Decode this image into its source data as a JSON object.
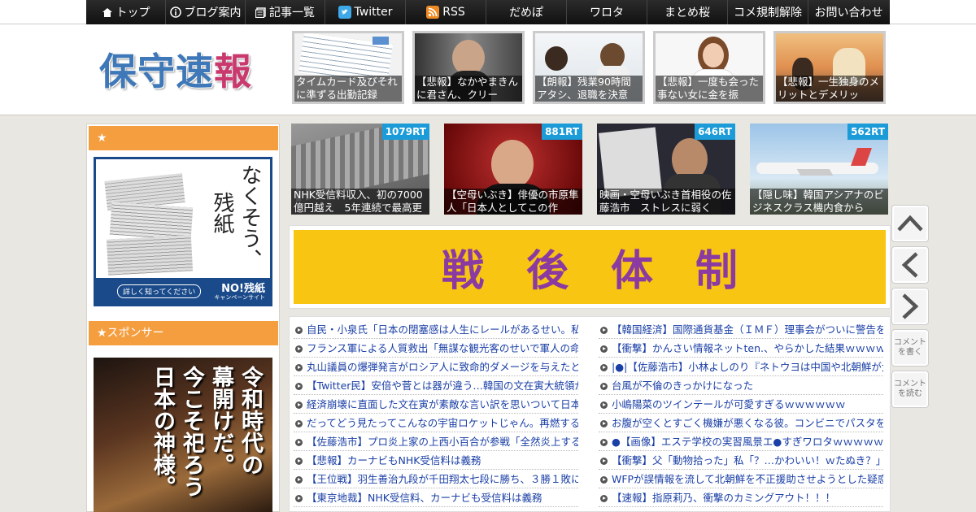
{
  "nav": [
    {
      "label": "トップ",
      "icon": "home-icon"
    },
    {
      "label": "ブログ案内",
      "icon": "info-icon"
    },
    {
      "label": "記事一覧",
      "icon": "list-icon"
    },
    {
      "label": "Twitter",
      "icon": "twitter-icon"
    },
    {
      "label": "RSS",
      "icon": "rss-icon"
    },
    {
      "label": "だめぽ",
      "icon": ""
    },
    {
      "label": "ワロタ",
      "icon": ""
    },
    {
      "label": "まとめ桜",
      "icon": ""
    },
    {
      "label": "コメ規制解除",
      "icon": ""
    },
    {
      "label": "お問い合わせ",
      "icon": ""
    }
  ],
  "logo": {
    "c1": "保",
    "c2": "守",
    "c3": "速",
    "c4": "報"
  },
  "header_thumbs": [
    {
      "caption": "タイムカード及びそれに準ずる出勤記録"
    },
    {
      "caption": "【悲報】なかやまきんに君さん、クリー"
    },
    {
      "caption": "【朗報】残業90時間アタシ、退職を決意"
    },
    {
      "caption": "【悲報】一度も会った事ない女に金を振"
    },
    {
      "caption": "【悲報】一生独身のメリットとデメリッ"
    }
  ],
  "sidebar": {
    "head1": "★",
    "head2": "★スポンサー",
    "banner1": {
      "vtext1": "なくそう、",
      "vtext2": "残紙",
      "button": "詳しく知ってください",
      "brand": "NO!残紙",
      "brand_sub": "キャンペーンサイト"
    },
    "banner2": {
      "col1": "令和時代の",
      "col2": "幕開けだ。",
      "col3": "今こそ祀ろう",
      "col4": "日本の神様。"
    }
  },
  "ranking": [
    {
      "rt": "1079RT",
      "caption": "NHK受信料収入、初の7000億円越え　5年連続で最高更"
    },
    {
      "rt": "881RT",
      "caption": "【空母いぶき】俳優の市原隼人「日本人としてこの作"
    },
    {
      "rt": "646RT",
      "caption": "映画・空母いぶき首相役の佐藤浩市　ストレスに弱く"
    },
    {
      "rt": "562RT",
      "caption": "【隠し味】韓国アシアナのビジネスクラス機内食から"
    }
  ],
  "kanban": [
    "戦",
    "後",
    "体",
    "制"
  ],
  "news_left": [
    "自民・小泉氏「日本の閉塞感は人生にレールがあるせい。私が",
    "フランス軍による人質救出「無謀な観光客のせいで軍人の命が",
    "丸山議員の爆弾発言がロシア人に致命的ダメージを与えたと発",
    "【Twitter民】安倍や菅とは器が違う…韓国の文在寅大統領が羨",
    "経済崩壊に直面した文在寅が素敵な言い訳を思いついて日本側",
    "だってどう見たってこんなの宇宙ロケットじゃん。再燃するマ",
    "【佐藤浩市】プロ炎上家の上西小百合が参戦「全然炎上するよ",
    "【悲報】カーナビもNHK受信料は義務",
    "【王位戦】羽生善治九段が千田翔太七段に勝ち、３勝１敗に",
    "【東京地裁】NHK受信料、カーナビも受信料は義務"
  ],
  "news_right": [
    "【韓国経済】国際通貨基金（ＩＭＦ）理事会がついに警告を発",
    "【衝撃】かんさい情報ネットten.、やらかした結果ｗｗｗｗｗ",
    "|●|【佐藤浩市】小林よしのり『ネトウヨは中国や北朝鮮が大好",
    "台風が不倫のきっかけになった",
    "小嶋陽菜のツインテールが可愛すぎるｗｗｗｗｗｗ",
    "お腹が空くとすごく機嫌が悪くなる彼。コンビニでパスタを買",
    "●【画像】エステ学校の実習風景エ●すぎワロタｗｗｗｗｗ",
    "【衝撃】父「動物拾った」私「？…かわいい！ｗたぬき？」→",
    "WFPが誤情報を流して北朝鮮を不正援助させようとした疑惑が",
    "【速報】指原莉乃、衝撃のカミングアウト！！！"
  ],
  "floatnav": {
    "comment_write": "コメントを書く",
    "comment_read": "コメントを読む"
  }
}
